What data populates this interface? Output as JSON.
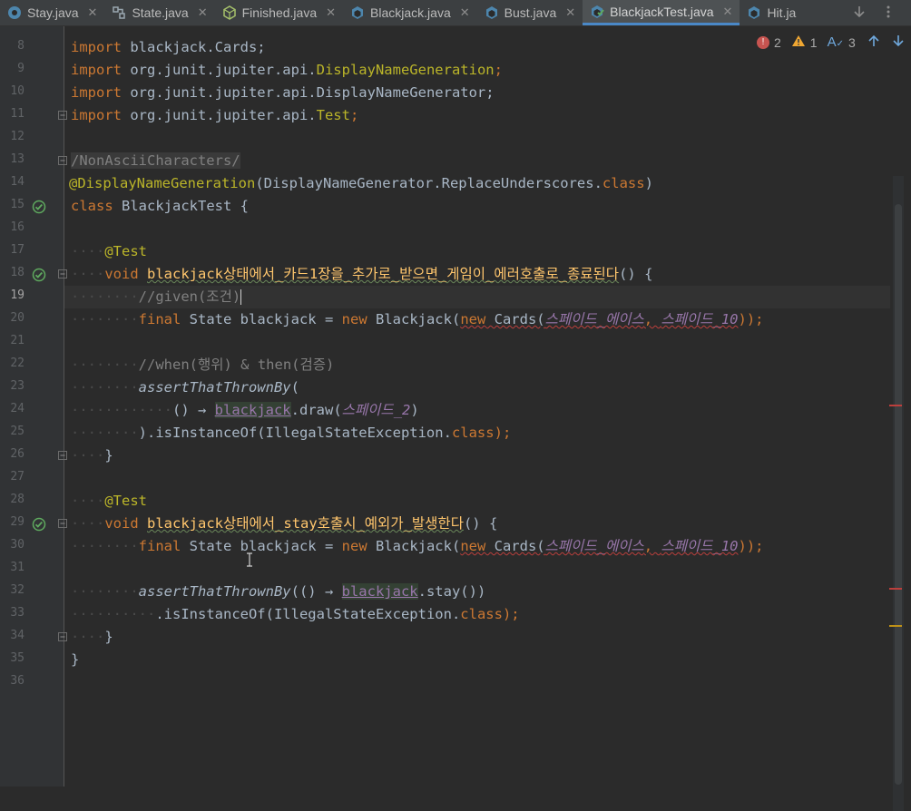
{
  "tabs": [
    {
      "label": "Stay.java",
      "icon": "java-class-icon",
      "close": "✕"
    },
    {
      "label": "State.java",
      "icon": "structure-icon",
      "close": "✕"
    },
    {
      "label": "Finished.java",
      "icon": "abstract-class-icon",
      "close": "✕"
    },
    {
      "label": "Blackjack.java",
      "icon": "java-class-icon",
      "close": "✕"
    },
    {
      "label": "Bust.java",
      "icon": "java-class-icon",
      "close": "✕"
    },
    {
      "label": "BlackjackTest.java",
      "icon": "test-class-icon",
      "close": "✕",
      "active": true
    },
    {
      "label": "Hit.ja",
      "icon": "java-class-icon"
    }
  ],
  "inspection": {
    "errors": "2",
    "warnings": "1",
    "typos": "3"
  },
  "line_numbers": [
    "8",
    "9",
    "10",
    "11",
    "12",
    "13",
    "14",
    "15",
    "16",
    "17",
    "18",
    "19",
    "20",
    "21",
    "22",
    "23",
    "24",
    "25",
    "26",
    "27",
    "28",
    "29",
    "30",
    "31",
    "32",
    "33",
    "34",
    "35",
    "36"
  ],
  "current_line": "19",
  "code": {
    "l8": {
      "kw": "import",
      "rest": " blackjack.Cards;"
    },
    "l9": {
      "kw": "import",
      "rest": " org.junit.jupiter.api.",
      "ann": "DisplayNameGeneration",
      "end": ";"
    },
    "l10": {
      "kw": "import",
      "rest": " org.junit.jupiter.api.DisplayNameGenerator;"
    },
    "l11": {
      "kw": "import",
      "rest": " org.junit.jupiter.api.",
      "ann": "Test",
      "end": ";"
    },
    "l13": {
      "text": "/NonAsciiCharacters/"
    },
    "l14": {
      "ann": "@DisplayNameGeneration",
      "rest": "(DisplayNameGenerator.ReplaceUnderscores.",
      "kw": "class",
      "end": ")"
    },
    "l15": {
      "kw": "class",
      "rest": " BlackjackTest {"
    },
    "l17": {
      "ws": "····",
      "ann": "@Test"
    },
    "l18": {
      "ws": "····",
      "kw": "void",
      "fn": "blackjack상태에서_카드1장을_추가로_받으면_게임이_에러호출로_종료된다",
      "rest": "() {"
    },
    "l19": {
      "ws": "········",
      "cm": "//given(조건)"
    },
    "l20": {
      "ws": "········",
      "kw1": "final",
      "t1": " State ",
      "v": "blackjack",
      "t2": " = ",
      "kw2": "new",
      "t3": " Blackjack(",
      "kw3": "new",
      "t4": " Cards(",
      "c1": "스페이드_에이스",
      "t5": ", ",
      "c2": "스페이드_10",
      "t6": "));"
    },
    "l22": {
      "ws": "········",
      "cm": "//when(행위) & then(검증)"
    },
    "l23": {
      "ws": "········",
      "it": "assertThatThrownBy",
      "rest": "("
    },
    "l24": {
      "ws": "············",
      "t1": "() → ",
      "v": "blackjack",
      "t2": ".draw(",
      "c1": "스페이드_2",
      "t3": ")"
    },
    "l25": {
      "ws": "········",
      "t1": ").isInstanceOf(IllegalStateException.",
      "kw": "class",
      "t2": ");"
    },
    "l26": {
      "ws": "····",
      "rest": "}"
    },
    "l28": {
      "ws": "····",
      "ann": "@Test"
    },
    "l29": {
      "ws": "····",
      "kw": "void",
      "fn": "blackjack상태에서_stay호출시_예외가_발생한다",
      "rest": "() {"
    },
    "l30": {
      "ws": "········",
      "kw1": "final",
      "t1": " State ",
      "v": "blackjack",
      "t2": " = ",
      "kw2": "new",
      "t3": " Blackjack(",
      "kw3": "new",
      "t4": " Cards(",
      "c1": "스페이드_에이스",
      "t5": ", ",
      "c2": "스페이드_10",
      "t6": "));"
    },
    "l32": {
      "ws": "········",
      "it": "assertThatThrownBy",
      "t1": "(() → ",
      "v": "blackjack",
      "t2": ".stay())"
    },
    "l33": {
      "ws": "··········",
      "t1": ".isInstanceOf(IllegalStateException.",
      "kw": "class",
      "t2": ");"
    },
    "l34": {
      "ws": "····",
      "rest": "}"
    },
    "l35": {
      "rest": "}"
    }
  },
  "colors": {
    "keyword": "#cc7832",
    "annotation": "#bbb529",
    "method": "#ffc66d",
    "comment": "#808080",
    "constant": "#9876aa",
    "text": "#a9b7c6",
    "background": "#2b2b2b",
    "run_icon": "#5faa5f"
  }
}
